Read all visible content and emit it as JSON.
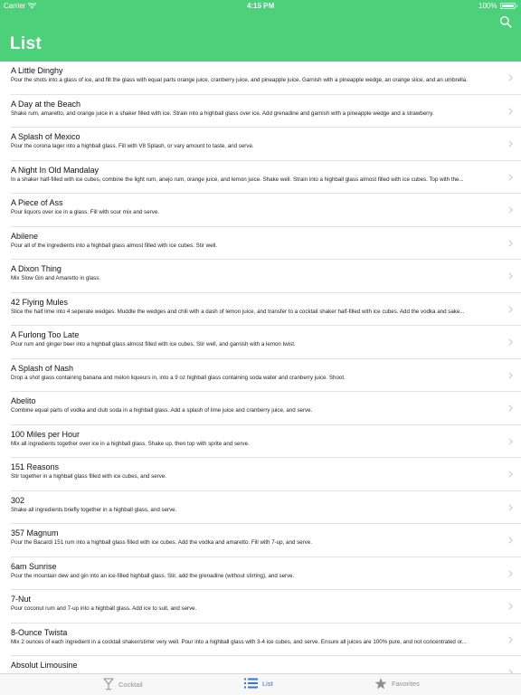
{
  "status": {
    "carrier": "Carrier",
    "time": "4:15 PM",
    "battery": "100%"
  },
  "header": {
    "title": "List"
  },
  "icons": {
    "search": "search-icon",
    "chevron": "chevron-right-icon",
    "cocktail": "cocktail-glass-icon",
    "list": "list-icon",
    "favorites": "star-icon"
  },
  "colors": {
    "header_bg": "#4cd079",
    "tab_active": "#3a72d8",
    "tab_inactive": "#8e8e93"
  },
  "items": [
    {
      "title": "A Little Dinghy",
      "desc": "Pour the shots into a glass of ice, and fill the glass with equal parts orange juice, cranberry juice, and pineapple juice. Garnish with a pineapple wedge, an orange slice, and an umbrella."
    },
    {
      "title": "A Day at the Beach",
      "desc": "Shake rum, amaretto, and orange juice in a shaker filled with ice. Strain into a highball glass over ice. Add grenadine and garnish with a pineapple wedge and a strawberry."
    },
    {
      "title": "A Splash of Mexico",
      "desc": "Pour the corona lager into a highball glass. Fill with V8 Splash, or vary amount to taste, and serve."
    },
    {
      "title": "A Night In Old Mandalay",
      "desc": "In a shaker half-filled with ice cubes, combine the light rum, anejo rum, orange juice, and lemon juice. Shake well. Strain into a highball glass almost filled with ice cubes. Top with the..."
    },
    {
      "title": "A Piece of Ass",
      "desc": "Pour liquors over ice in a glass. Fill with sour mix and serve."
    },
    {
      "title": "Abilene",
      "desc": "Pour all of the ingredients into a highball glass almost filled with ice cubes. Stir well."
    },
    {
      "title": "A Dixon Thing",
      "desc": "Mix Slow Gin and Amaretto in glass."
    },
    {
      "title": "42 Flying Mules",
      "desc": "Slice the half lime into 4 seperate wedges. Muddle the wedges and chili with a dash of lemon juice, and transfer to a cocktail shaker half-filled with ice cubes. Add the vodka and sake..."
    },
    {
      "title": "A Furlong Too Late",
      "desc": "Pour rum and ginger beer into a highball glass almost filled with ice cubes. Stir well, and garnish with a lemon twist."
    },
    {
      "title": "A Splash of Nash",
      "desc": "Drop a shot glass containing banana and melon liqueurs in, into a 9 oz highball glass containing soda water and cranberry juice. Shoot."
    },
    {
      "title": "Abelito",
      "desc": "Combine equal parts of vodka and club soda in a highball glass. Add a splash of lime juice and cranberry juice, and serve."
    },
    {
      "title": "100 Miles per Hour",
      "desc": "Mix all ingredients together over ice in a highball glass. Shake up, then top with sprite and serve."
    },
    {
      "title": "151 Reasons",
      "desc": "Stir together in a highball glass filled with ice cubes, and serve."
    },
    {
      "title": "302",
      "desc": "Shake all ingredients briefly together in a highball glass, and serve."
    },
    {
      "title": "357 Magnum",
      "desc": "Pour the Bacardi 151 rum into a highball glass filled with ice cubes. Add the vodka and amaretto. Fill with 7-up, and serve."
    },
    {
      "title": "6am Sunrise",
      "desc": "Pour the mountain dew and gin into an ice-filled highball glass. Stir, add the grenadine (without stirring), and serve."
    },
    {
      "title": "7-Nut",
      "desc": "Pour coconut rum and 7-up into a highball glass. Add ice to suit, and serve."
    },
    {
      "title": "8-Ounce Twista",
      "desc": "Mix 2 ounces of each ingredient in a cocktail shaker/stirrer very well. Pour into a highball glass with 3-4 ice cubes, and serve. Ensure all juices are 100% pure, and not concentrated or..."
    },
    {
      "title": "Absolut Limousine",
      "desc": ""
    }
  ],
  "tabs": [
    {
      "label": "Cocktail",
      "active": false
    },
    {
      "label": "List",
      "active": true
    },
    {
      "label": "Favorites",
      "active": false
    }
  ]
}
